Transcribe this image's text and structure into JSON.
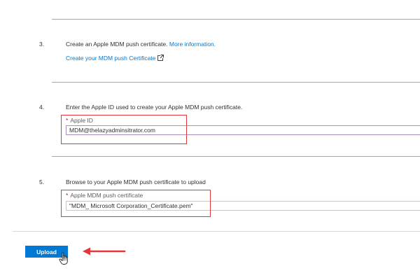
{
  "steps": [
    {
      "number": "3.",
      "text_before": "Create an Apple MDM push certificate. ",
      "more_info_link": "More information.",
      "create_link": "Create your MDM push Certificate"
    },
    {
      "number": "4.",
      "text": "Enter the Apple ID used to create your Apple MDM push certificate.",
      "field_label": "Apple ID",
      "field_value": "MDM@thelazyadminsitrator.com"
    },
    {
      "number": "5.",
      "text": "Browse to your Apple MDM push certificate to upload",
      "field_label": "Apple MDM push certificate",
      "field_value": "\"MDM_ Microsoft Corporation_Certificate.pem\""
    }
  ],
  "required_marker": "*",
  "upload_button": "Upload",
  "icons": {
    "external_link": "external-link-icon",
    "cursor": "hand-pointer-icon",
    "arrow": "red-arrow-left-icon"
  },
  "colors": {
    "link": "#0078d4",
    "button": "#0078d4",
    "highlight": "#e5363b",
    "required": "#a4262c"
  }
}
